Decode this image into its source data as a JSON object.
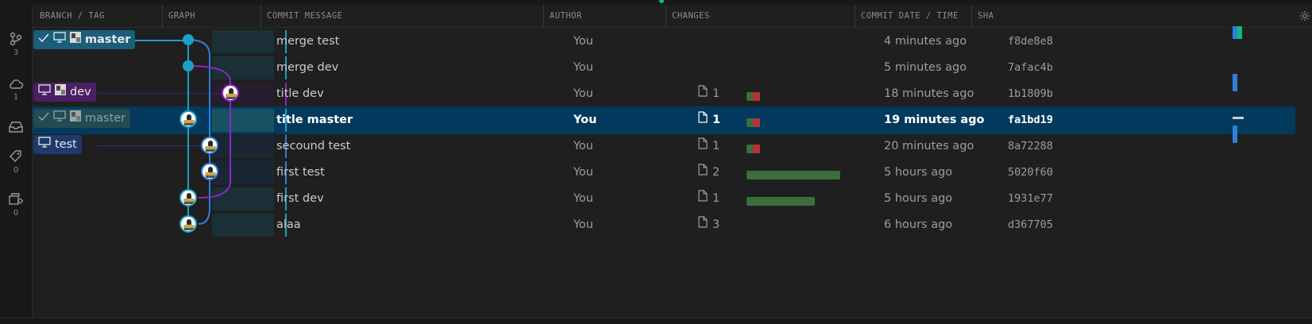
{
  "headers": {
    "branch": "BRANCH / TAG",
    "graph": "GRAPH",
    "message": "COMMIT MESSAGE",
    "author": "AUTHOR",
    "changes": "CHANGES",
    "date": "COMMIT DATE / TIME",
    "sha": "SHA"
  },
  "sidebar": {
    "items": [
      {
        "icon": "branches-icon",
        "count": "3"
      },
      {
        "icon": "cloud-icon",
        "count": "1"
      },
      {
        "icon": "inbox-icon",
        "count": ""
      },
      {
        "icon": "tag-icon",
        "count": "0"
      },
      {
        "icon": "worktree-icon",
        "count": "0"
      }
    ]
  },
  "refs": [
    {
      "label": "master",
      "row": 0,
      "checked": true,
      "dimmed": false,
      "color": "#1b5e7a"
    },
    {
      "label": "dev",
      "row": 2,
      "checked": false,
      "dimmed": false,
      "color": "#4b1f66"
    },
    {
      "label": "master",
      "row": 3,
      "checked": true,
      "dimmed": true,
      "color": "#244a52"
    },
    {
      "label": "test",
      "row": 4,
      "checked": false,
      "dimmed": false,
      "color": "#1f3a6a"
    }
  ],
  "commits": [
    {
      "message": "merge test",
      "author": "You",
      "files": "",
      "date": "4 minutes ago",
      "sha": "f8de8e8"
    },
    {
      "message": "merge dev",
      "author": "You",
      "files": "",
      "date": "5 minutes ago",
      "sha": "7afac4b"
    },
    {
      "message": "title dev",
      "author": "You",
      "files": "1",
      "date": "18 minutes ago",
      "sha": "1b1809b"
    },
    {
      "message": "title master",
      "author": "You",
      "files": "1",
      "date": "19 minutes ago",
      "sha": "fa1bd19"
    },
    {
      "message": "secound test",
      "author": "You",
      "files": "1",
      "date": "20 minutes ago",
      "sha": "8a72288"
    },
    {
      "message": "first test",
      "author": "You",
      "files": "2",
      "date": "5 hours ago",
      "sha": "5020f60"
    },
    {
      "message": "first dev",
      "author": "You",
      "files": "1",
      "date": "5 hours ago",
      "sha": "1931e77"
    },
    {
      "message": "alaa",
      "author": "You",
      "files": "3",
      "date": "6 hours ago",
      "sha": "d367705"
    }
  ],
  "colors": {
    "lane_master": "#1ba1c7",
    "lane_test": "#2f7fd9",
    "lane_dev": "#8e24c7",
    "selected": "#04395e",
    "additions": "#3c6e3c",
    "deletions": "#b23434"
  }
}
